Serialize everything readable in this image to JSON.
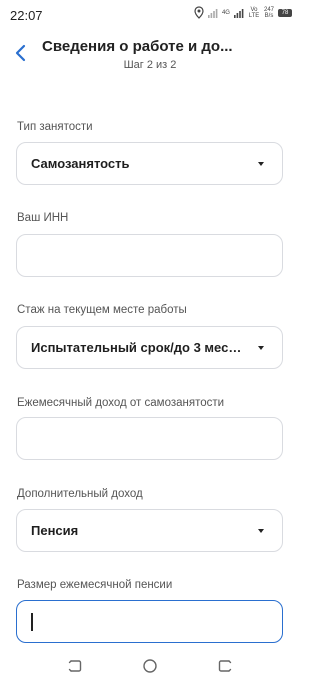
{
  "status": {
    "time": "22:07",
    "net_label": "4G",
    "volte_label": "Vo LTE",
    "speed_value": "247",
    "speed_unit": "B/s",
    "battery_level": "78"
  },
  "header": {
    "title": "Сведения о работе и до...",
    "step": "Шаг 2 из 2"
  },
  "fields": [
    {
      "label": "Тип занятости",
      "type": "select",
      "value": "Самозанятость"
    },
    {
      "label": "Ваш ИНН",
      "type": "input",
      "value": ""
    },
    {
      "label": "Стаж на текущем месте работы",
      "type": "select",
      "value": "Испытательный срок/до 3 меся..."
    },
    {
      "label": "Ежемесячный доход от самозанятости",
      "type": "input",
      "value": ""
    },
    {
      "label": "Дополнительный доход",
      "type": "select",
      "value": "Пенсия"
    },
    {
      "label": "Размер ежемесячной пенсии",
      "type": "input",
      "value": "",
      "focused": true
    }
  ],
  "colors": {
    "accent": "#2a6fcf",
    "border": "#d9dbe0",
    "label": "#555555"
  }
}
